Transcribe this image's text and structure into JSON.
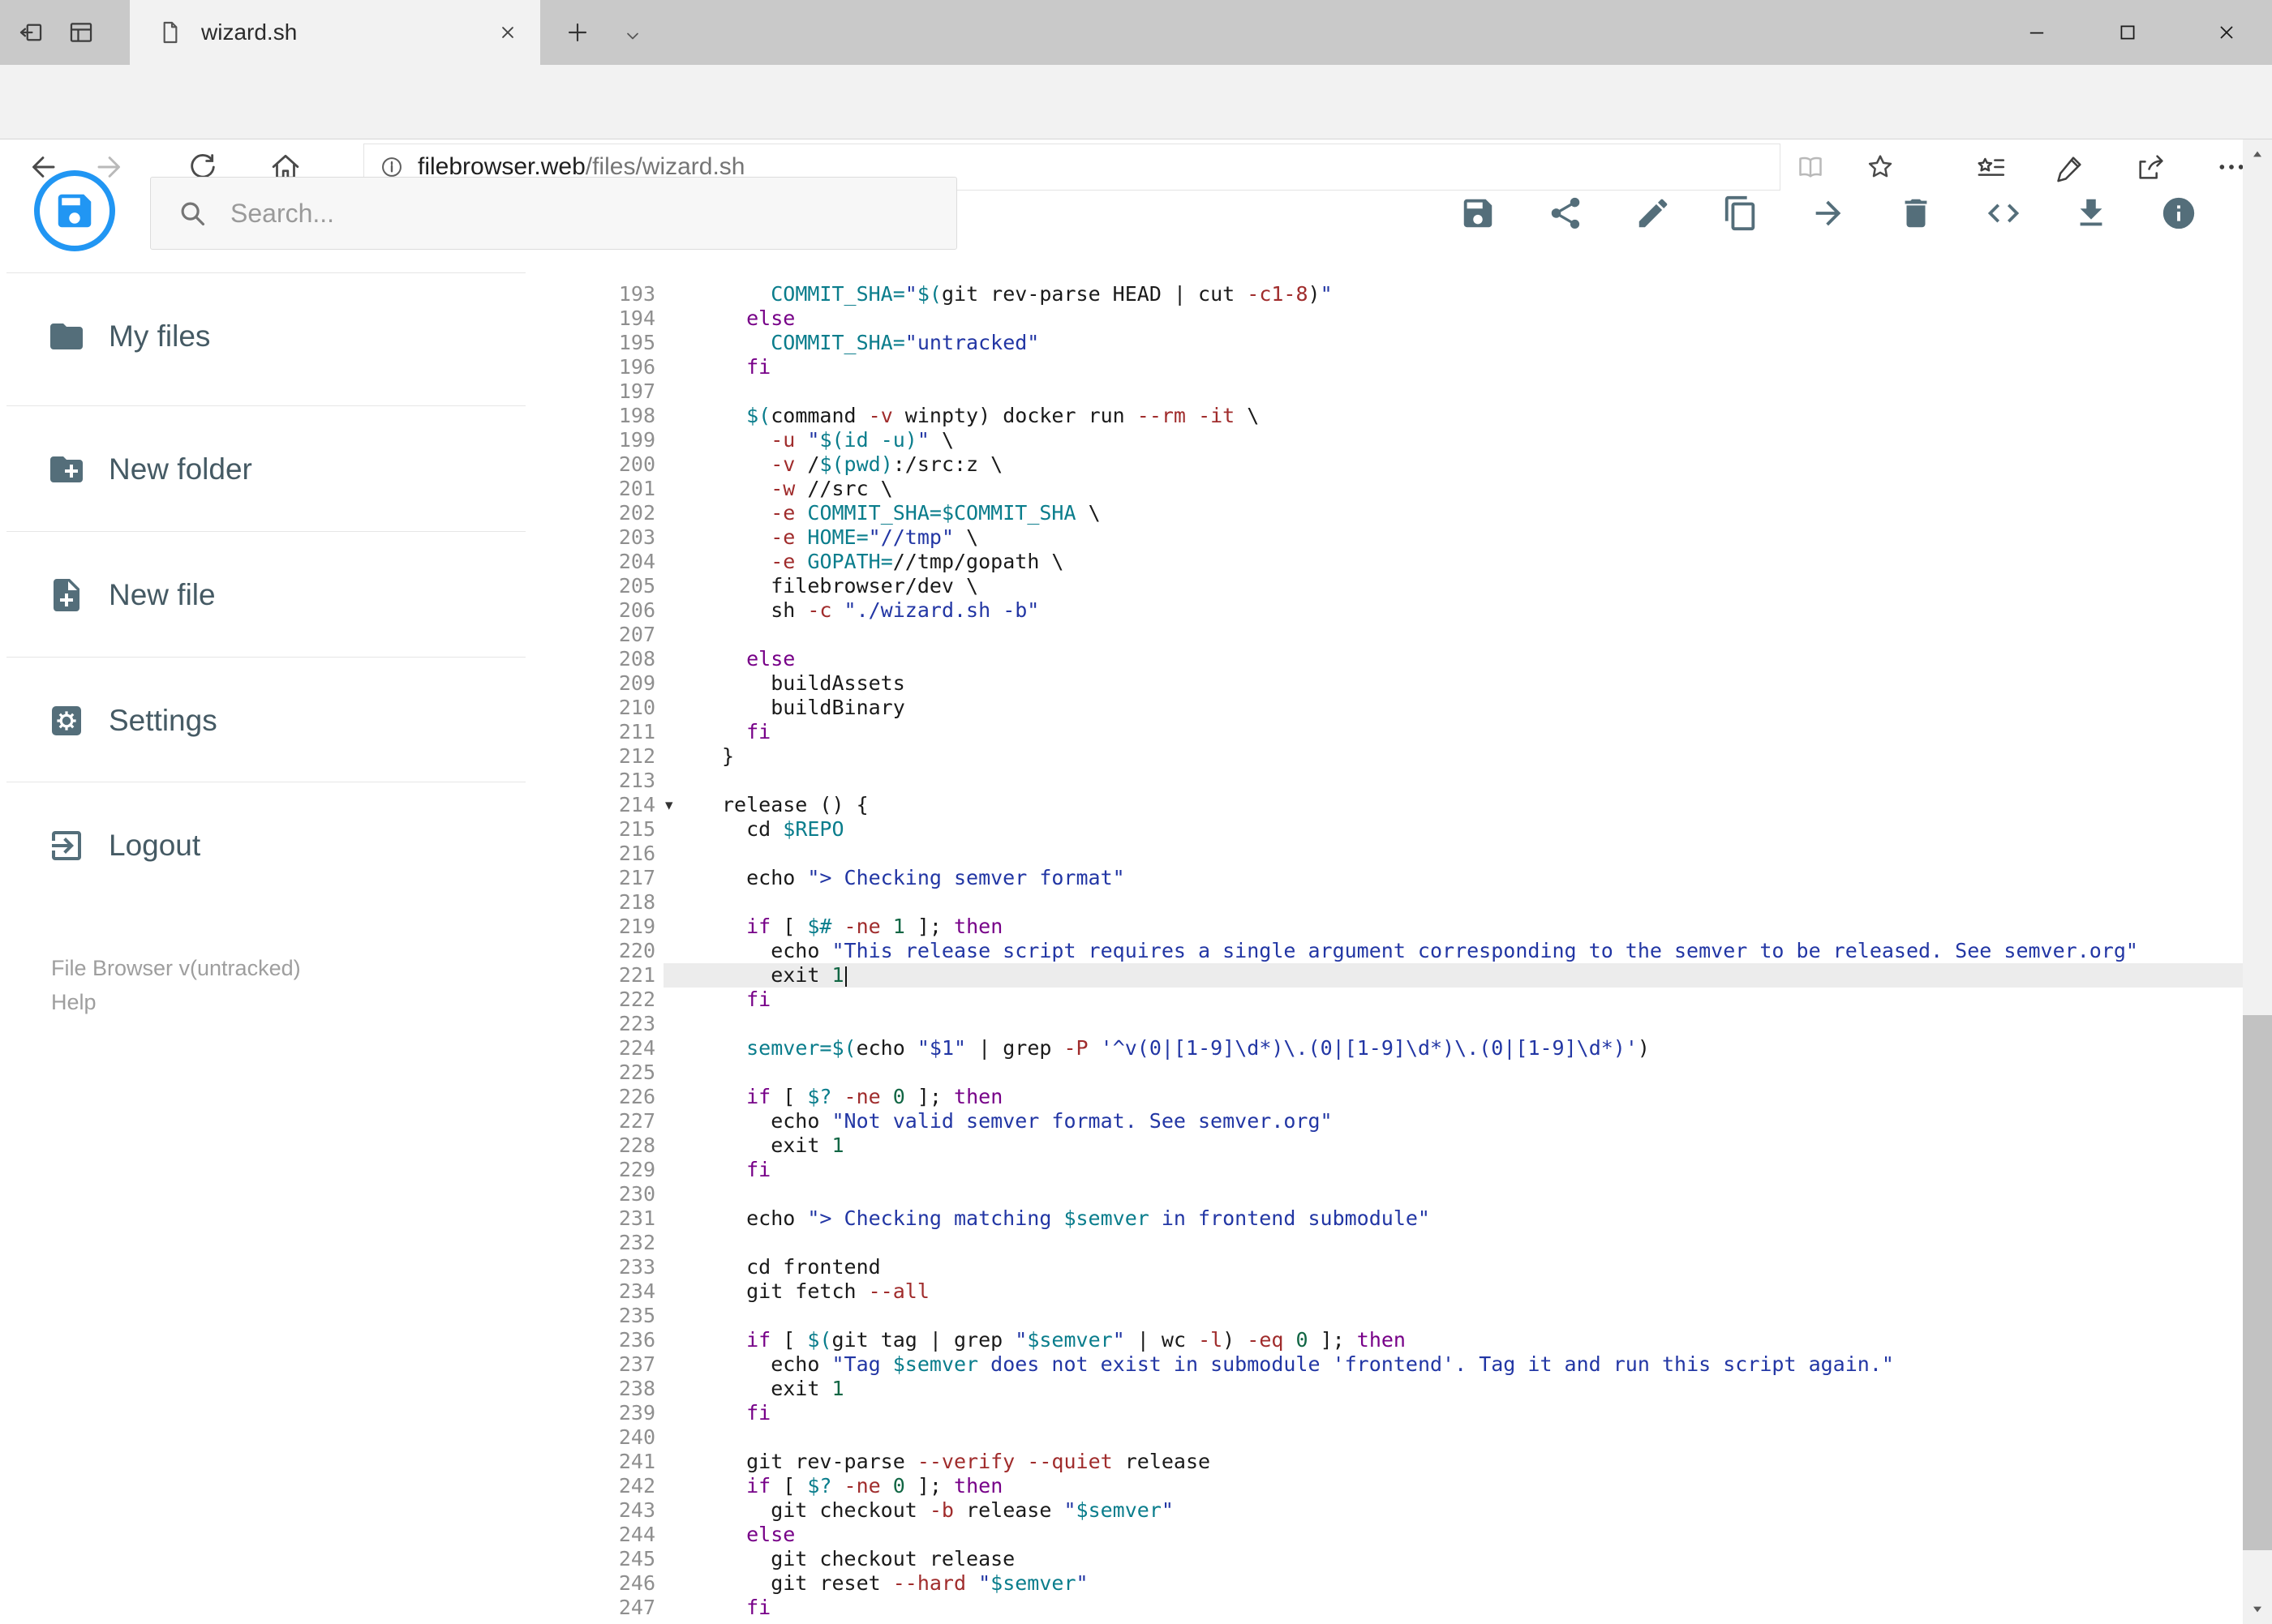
{
  "browser": {
    "tab": {
      "title": "wizard.sh"
    },
    "address": {
      "host": "filebrowser.web",
      "path": "/files/wizard.sh"
    },
    "nav_icons": [
      "back",
      "forward",
      "refresh",
      "home",
      "site-info",
      "reading-view",
      "favorite-star",
      "hub",
      "web-note",
      "share",
      "more"
    ]
  },
  "app": {
    "search": {
      "placeholder": "Search..."
    },
    "toolbar": [
      {
        "icon": "save"
      },
      {
        "icon": "share"
      },
      {
        "icon": "edit"
      },
      {
        "icon": "copy"
      },
      {
        "icon": "move"
      },
      {
        "icon": "delete"
      },
      {
        "icon": "code"
      },
      {
        "icon": "download"
      },
      {
        "icon": "info"
      }
    ],
    "sidebar": {
      "items": [
        {
          "icon": "folder",
          "label": "My files"
        },
        {
          "icon": "create-new-folder",
          "label": "New folder"
        },
        {
          "icon": "new-file",
          "label": "New file"
        },
        {
          "icon": "settings",
          "label": "Settings"
        },
        {
          "icon": "logout",
          "label": "Logout"
        }
      ],
      "footer": {
        "version": "File Browser v(untracked)",
        "help": "Help"
      }
    },
    "colors": {
      "accent": "#2196f3",
      "icon": "#546e7a",
      "keyword": "#770088",
      "variable": "#0a7d8c",
      "string": "#2236a4",
      "number": "#116644",
      "attribute": "#a02c2c"
    }
  },
  "editor": {
    "first_line": 193,
    "last_line": 247,
    "active_line": 221,
    "lines": [
      {
        "n": 193,
        "tok": [
          [
            "t",
            "    "
          ],
          [
            "v",
            "COMMIT_SHA="
          ],
          [
            "s",
            "\""
          ],
          [
            "v",
            "$("
          ],
          [
            "t",
            "git rev-parse HEAD | cut "
          ],
          [
            "a",
            "-c1-8"
          ],
          [
            "t",
            ")"
          ],
          [
            "s",
            "\""
          ]
        ]
      },
      {
        "n": 194,
        "tok": [
          [
            "t",
            "  "
          ],
          [
            "k",
            "else"
          ]
        ]
      },
      {
        "n": 195,
        "tok": [
          [
            "t",
            "    "
          ],
          [
            "v",
            "COMMIT_SHA="
          ],
          [
            "s",
            "\"untracked\""
          ]
        ]
      },
      {
        "n": 196,
        "tok": [
          [
            "t",
            "  "
          ],
          [
            "k",
            "fi"
          ]
        ]
      },
      {
        "n": 197,
        "tok": []
      },
      {
        "n": 198,
        "tok": [
          [
            "t",
            "  "
          ],
          [
            "v",
            "$("
          ],
          [
            "t",
            "command "
          ],
          [
            "a",
            "-v"
          ],
          [
            "t",
            " winpty) docker run "
          ],
          [
            "a",
            "--rm"
          ],
          [
            "t",
            " "
          ],
          [
            "a",
            "-it"
          ],
          [
            "t",
            " \\"
          ]
        ]
      },
      {
        "n": 199,
        "tok": [
          [
            "t",
            "    "
          ],
          [
            "a",
            "-u"
          ],
          [
            "t",
            " "
          ],
          [
            "s",
            "\""
          ],
          [
            "v",
            "$(id -u)"
          ],
          [
            "s",
            "\""
          ],
          [
            "t",
            " \\"
          ]
        ]
      },
      {
        "n": 200,
        "tok": [
          [
            "t",
            "    "
          ],
          [
            "a",
            "-v"
          ],
          [
            "t",
            " /"
          ],
          [
            "v",
            "$(pwd)"
          ],
          [
            "t",
            ":/src:z \\"
          ]
        ]
      },
      {
        "n": 201,
        "tok": [
          [
            "t",
            "    "
          ],
          [
            "a",
            "-w"
          ],
          [
            "t",
            " //src \\"
          ]
        ]
      },
      {
        "n": 202,
        "tok": [
          [
            "t",
            "    "
          ],
          [
            "a",
            "-e"
          ],
          [
            "t",
            " "
          ],
          [
            "v",
            "COMMIT_SHA=$COMMIT_SHA"
          ],
          [
            "t",
            " \\"
          ]
        ]
      },
      {
        "n": 203,
        "tok": [
          [
            "t",
            "    "
          ],
          [
            "a",
            "-e"
          ],
          [
            "t",
            " "
          ],
          [
            "v",
            "HOME="
          ],
          [
            "s",
            "\"//tmp\""
          ],
          [
            "t",
            " \\"
          ]
        ]
      },
      {
        "n": 204,
        "tok": [
          [
            "t",
            "    "
          ],
          [
            "a",
            "-e"
          ],
          [
            "t",
            " "
          ],
          [
            "v",
            "GOPATH="
          ],
          [
            "t",
            "//tmp/gopath \\"
          ]
        ]
      },
      {
        "n": 205,
        "tok": [
          [
            "t",
            "    filebrowser/dev \\"
          ]
        ]
      },
      {
        "n": 206,
        "tok": [
          [
            "t",
            "    sh "
          ],
          [
            "a",
            "-c"
          ],
          [
            "t",
            " "
          ],
          [
            "s",
            "\"./wizard.sh -b\""
          ]
        ]
      },
      {
        "n": 207,
        "tok": []
      },
      {
        "n": 208,
        "tok": [
          [
            "t",
            "  "
          ],
          [
            "k",
            "else"
          ]
        ]
      },
      {
        "n": 209,
        "tok": [
          [
            "t",
            "    buildAssets"
          ]
        ]
      },
      {
        "n": 210,
        "tok": [
          [
            "t",
            "    buildBinary"
          ]
        ]
      },
      {
        "n": 211,
        "tok": [
          [
            "t",
            "  "
          ],
          [
            "k",
            "fi"
          ]
        ]
      },
      {
        "n": 212,
        "tok": [
          [
            "t",
            "}"
          ]
        ]
      },
      {
        "n": 213,
        "tok": []
      },
      {
        "n": 214,
        "fold": true,
        "tok": [
          [
            "t",
            "release () {"
          ]
        ]
      },
      {
        "n": 215,
        "tok": [
          [
            "t",
            "  cd "
          ],
          [
            "v",
            "$REPO"
          ]
        ]
      },
      {
        "n": 216,
        "tok": []
      },
      {
        "n": 217,
        "tok": [
          [
            "t",
            "  echo "
          ],
          [
            "s",
            "\"> Checking semver format\""
          ]
        ]
      },
      {
        "n": 218,
        "tok": []
      },
      {
        "n": 219,
        "tok": [
          [
            "t",
            "  "
          ],
          [
            "k",
            "if"
          ],
          [
            "t",
            " [ "
          ],
          [
            "v",
            "$#"
          ],
          [
            "t",
            " "
          ],
          [
            "a",
            "-ne"
          ],
          [
            "t",
            " "
          ],
          [
            "n",
            "1"
          ],
          [
            "t",
            " ]; "
          ],
          [
            "k",
            "then"
          ]
        ]
      },
      {
        "n": 220,
        "tok": [
          [
            "t",
            "    echo "
          ],
          [
            "s",
            "\"This release script requires a single argument corresponding to the semver to be released. See semver.org\""
          ]
        ]
      },
      {
        "n": 221,
        "active": true,
        "cursor": true,
        "tok": [
          [
            "t",
            "    exit "
          ],
          [
            "n",
            "1"
          ]
        ]
      },
      {
        "n": 222,
        "tok": [
          [
            "t",
            "  "
          ],
          [
            "k",
            "fi"
          ]
        ]
      },
      {
        "n": 223,
        "tok": []
      },
      {
        "n": 224,
        "tok": [
          [
            "t",
            "  "
          ],
          [
            "v",
            "semver=$("
          ],
          [
            "t",
            "echo "
          ],
          [
            "s",
            "\"$1\""
          ],
          [
            "t",
            " | grep "
          ],
          [
            "a",
            "-P"
          ],
          [
            "t",
            " "
          ],
          [
            "s",
            "'^v(0|[1-9]\\d*)\\.(0|[1-9]\\d*)\\.(0|[1-9]\\d*)'"
          ],
          [
            "t",
            ")"
          ]
        ]
      },
      {
        "n": 225,
        "tok": []
      },
      {
        "n": 226,
        "tok": [
          [
            "t",
            "  "
          ],
          [
            "k",
            "if"
          ],
          [
            "t",
            " [ "
          ],
          [
            "v",
            "$?"
          ],
          [
            "t",
            " "
          ],
          [
            "a",
            "-ne"
          ],
          [
            "t",
            " "
          ],
          [
            "n",
            "0"
          ],
          [
            "t",
            " ]; "
          ],
          [
            "k",
            "then"
          ]
        ]
      },
      {
        "n": 227,
        "tok": [
          [
            "t",
            "    echo "
          ],
          [
            "s",
            "\"Not valid semver format. See semver.org\""
          ]
        ]
      },
      {
        "n": 228,
        "tok": [
          [
            "t",
            "    exit "
          ],
          [
            "n",
            "1"
          ]
        ]
      },
      {
        "n": 229,
        "tok": [
          [
            "t",
            "  "
          ],
          [
            "k",
            "fi"
          ]
        ]
      },
      {
        "n": 230,
        "tok": []
      },
      {
        "n": 231,
        "tok": [
          [
            "t",
            "  echo "
          ],
          [
            "s",
            "\"> Checking matching "
          ],
          [
            "v",
            "$semver"
          ],
          [
            "s",
            " in frontend submodule\""
          ]
        ]
      },
      {
        "n": 232,
        "tok": []
      },
      {
        "n": 233,
        "tok": [
          [
            "t",
            "  cd frontend"
          ]
        ]
      },
      {
        "n": 234,
        "tok": [
          [
            "t",
            "  git fetch "
          ],
          [
            "a",
            "--all"
          ]
        ]
      },
      {
        "n": 235,
        "tok": []
      },
      {
        "n": 236,
        "tok": [
          [
            "t",
            "  "
          ],
          [
            "k",
            "if"
          ],
          [
            "t",
            " [ "
          ],
          [
            "v",
            "$("
          ],
          [
            "t",
            "git tag | grep "
          ],
          [
            "s",
            "\""
          ],
          [
            "v",
            "$semver"
          ],
          [
            "s",
            "\""
          ],
          [
            "t",
            " | wc "
          ],
          [
            "a",
            "-l"
          ],
          [
            "t",
            ") "
          ],
          [
            "a",
            "-eq"
          ],
          [
            "t",
            " "
          ],
          [
            "n",
            "0"
          ],
          [
            "t",
            " ]; "
          ],
          [
            "k",
            "then"
          ]
        ]
      },
      {
        "n": 237,
        "tok": [
          [
            "t",
            "    echo "
          ],
          [
            "s",
            "\"Tag "
          ],
          [
            "v",
            "$semver"
          ],
          [
            "s",
            " does not exist in submodule 'frontend'. Tag it and run this script again.\""
          ]
        ]
      },
      {
        "n": 238,
        "tok": [
          [
            "t",
            "    exit "
          ],
          [
            "n",
            "1"
          ]
        ]
      },
      {
        "n": 239,
        "tok": [
          [
            "t",
            "  "
          ],
          [
            "k",
            "fi"
          ]
        ]
      },
      {
        "n": 240,
        "tok": []
      },
      {
        "n": 241,
        "tok": [
          [
            "t",
            "  git rev-parse "
          ],
          [
            "a",
            "--verify"
          ],
          [
            "t",
            " "
          ],
          [
            "a",
            "--quiet"
          ],
          [
            "t",
            " release"
          ]
        ]
      },
      {
        "n": 242,
        "tok": [
          [
            "t",
            "  "
          ],
          [
            "k",
            "if"
          ],
          [
            "t",
            " [ "
          ],
          [
            "v",
            "$?"
          ],
          [
            "t",
            " "
          ],
          [
            "a",
            "-ne"
          ],
          [
            "t",
            " "
          ],
          [
            "n",
            "0"
          ],
          [
            "t",
            " ]; "
          ],
          [
            "k",
            "then"
          ]
        ]
      },
      {
        "n": 243,
        "tok": [
          [
            "t",
            "    git checkout "
          ],
          [
            "a",
            "-b"
          ],
          [
            "t",
            " release "
          ],
          [
            "s",
            "\""
          ],
          [
            "v",
            "$semver"
          ],
          [
            "s",
            "\""
          ]
        ]
      },
      {
        "n": 244,
        "tok": [
          [
            "t",
            "  "
          ],
          [
            "k",
            "else"
          ]
        ]
      },
      {
        "n": 245,
        "tok": [
          [
            "t",
            "    git checkout release"
          ]
        ]
      },
      {
        "n": 246,
        "tok": [
          [
            "t",
            "    git reset "
          ],
          [
            "a",
            "--hard"
          ],
          [
            "t",
            " "
          ],
          [
            "s",
            "\""
          ],
          [
            "v",
            "$semver"
          ],
          [
            "s",
            "\""
          ]
        ]
      },
      {
        "n": 247,
        "tok": [
          [
            "t",
            "  "
          ],
          [
            "k",
            "fi"
          ]
        ]
      }
    ]
  }
}
